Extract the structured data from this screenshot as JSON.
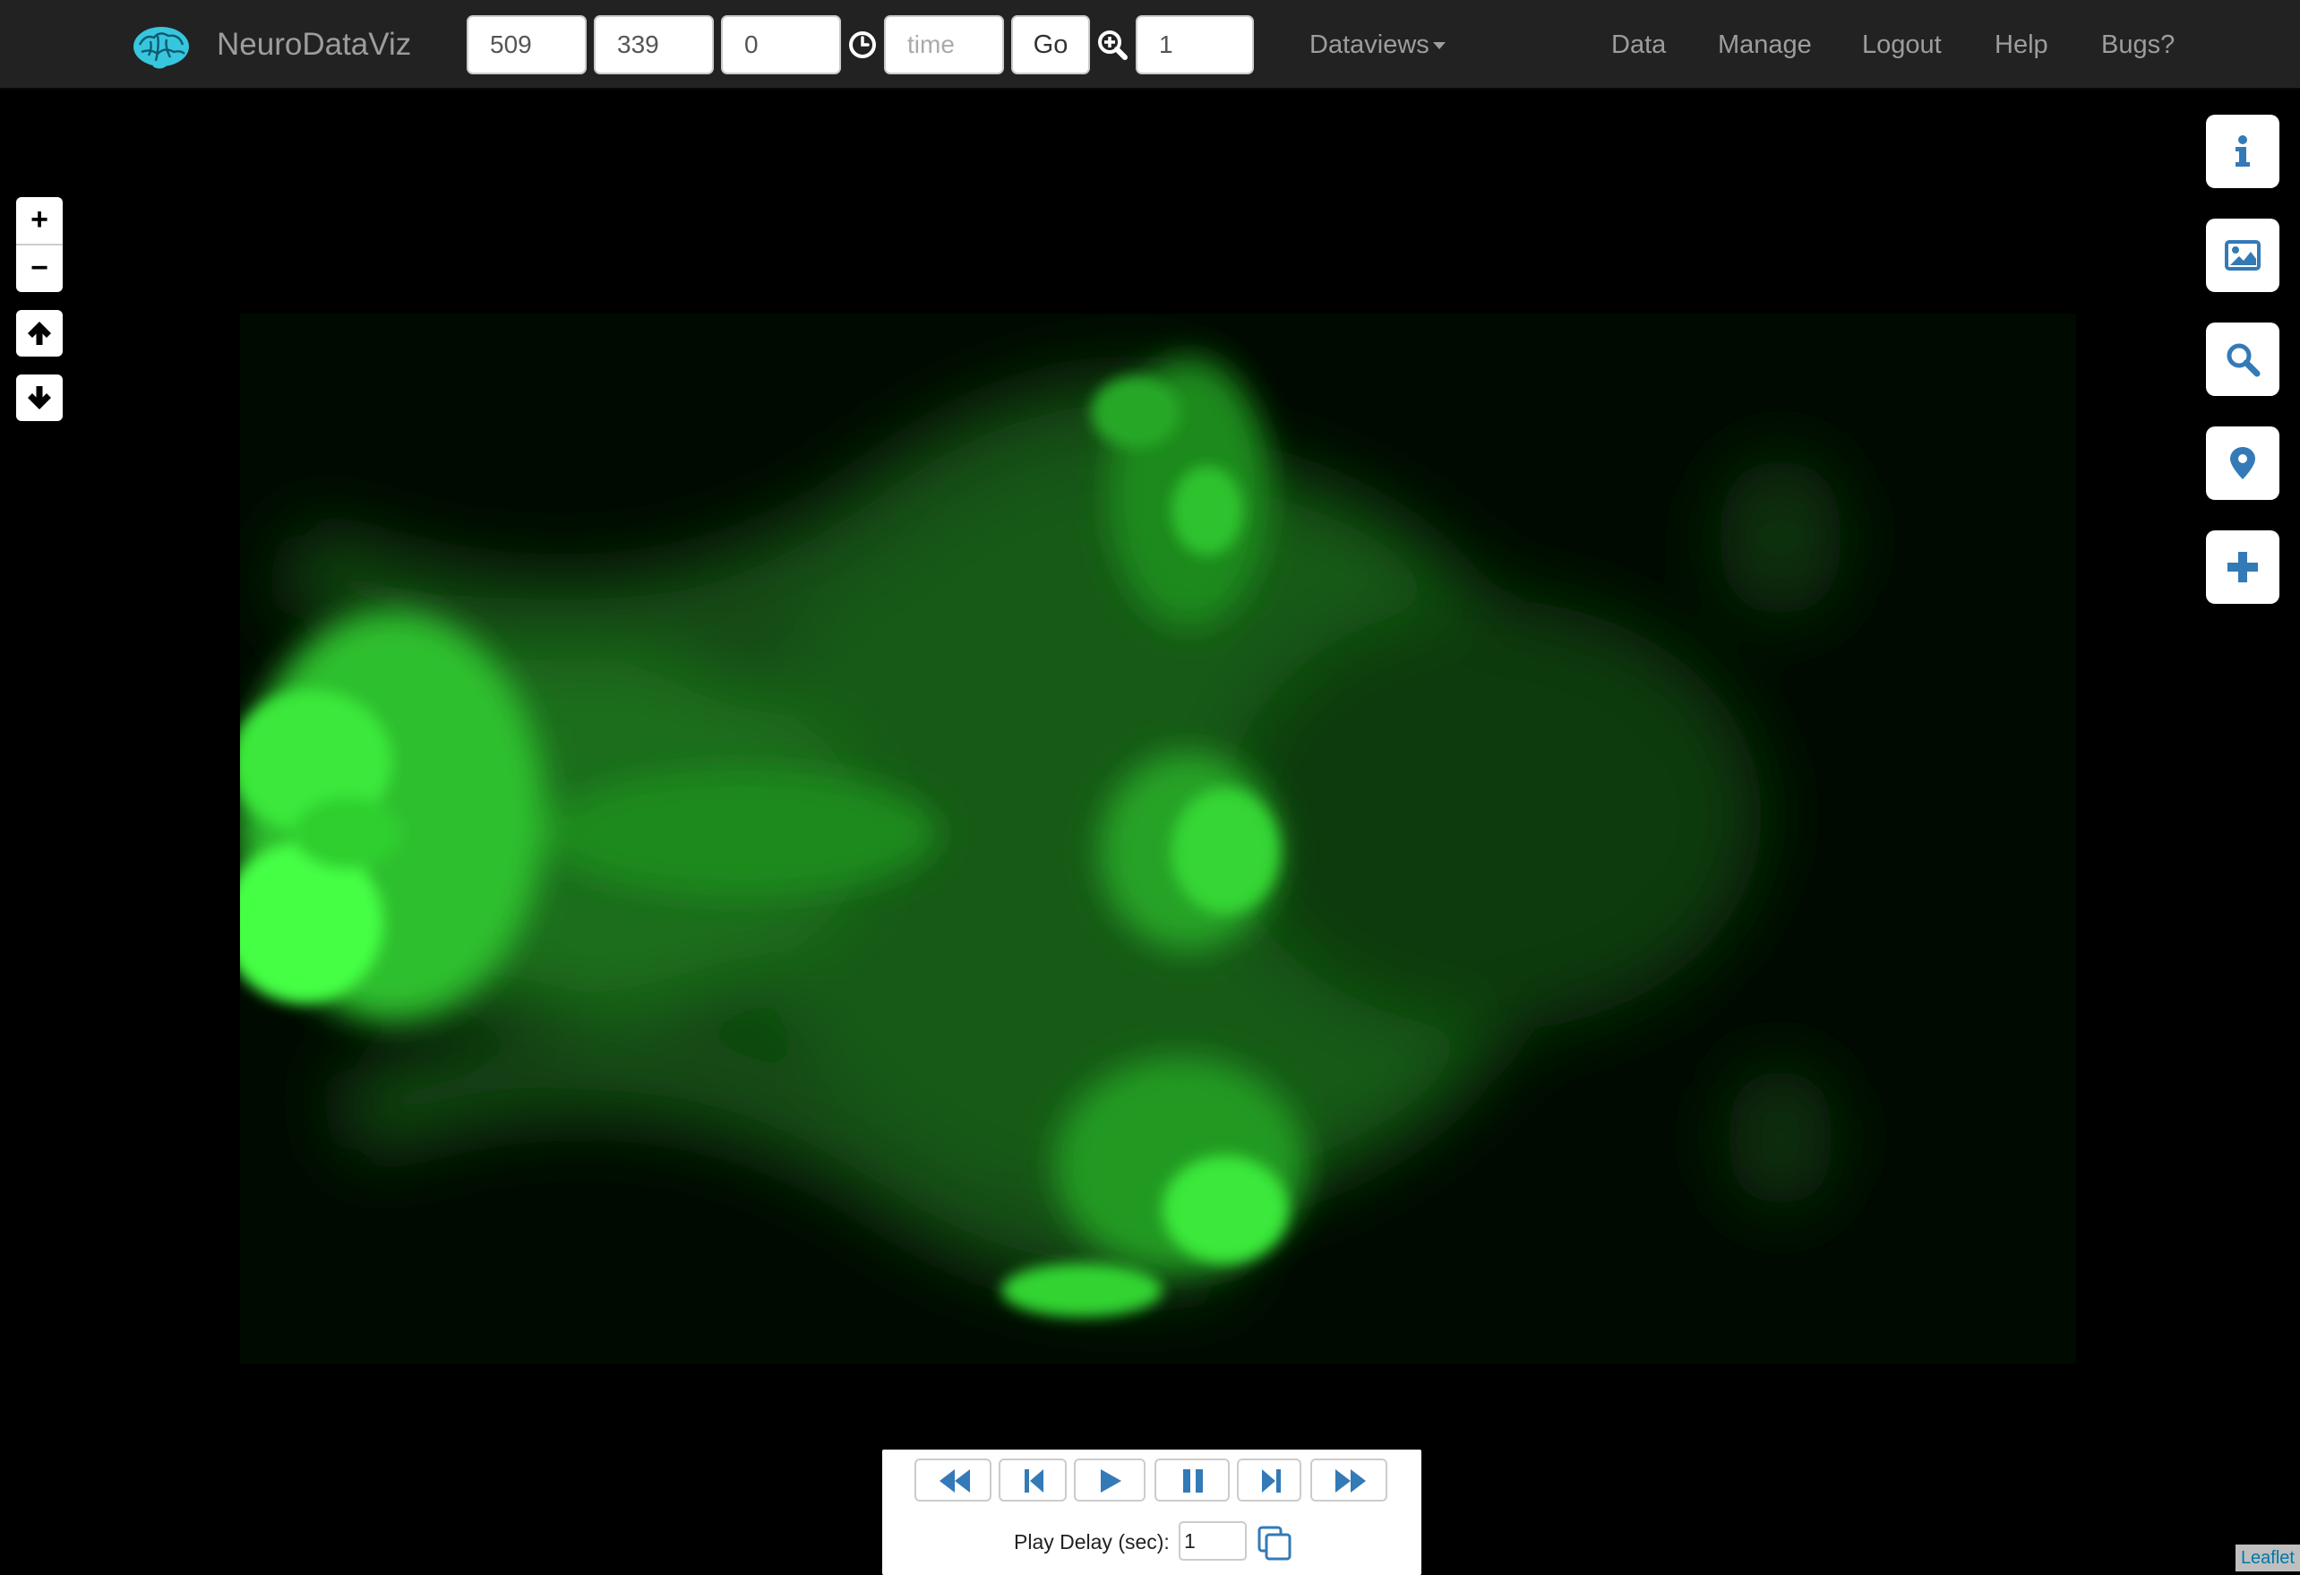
{
  "navbar": {
    "brand": "NeuroDataViz",
    "x_value": "509",
    "y_value": "339",
    "z_value": "0",
    "time_placeholder": "time",
    "go_label": "Go",
    "zoom_value": "1",
    "dataviews_label": "Dataviews",
    "links": {
      "data": "Data",
      "manage": "Manage",
      "logout": "Logout",
      "help": "Help",
      "bugs": "Bugs?"
    }
  },
  "map": {
    "zoom_in": "+",
    "zoom_out": "−",
    "side_buttons": [
      "info-icon",
      "image-icon",
      "search-icon",
      "map-marker-icon",
      "plus-icon"
    ],
    "nav_buttons": [
      "arrow-up-icon",
      "arrow-down-icon"
    ]
  },
  "playback": {
    "buttons": [
      "fast-backward-icon",
      "step-backward-icon",
      "play-icon",
      "pause-icon",
      "step-forward-icon",
      "fast-forward-icon"
    ],
    "delay_label": "Play Delay (sec):",
    "delay_value": "1"
  },
  "attribution": "Leaflet",
  "colors": {
    "navbar_bg": "#222222",
    "accent": "#337ab7",
    "fluorescence": "#22ff22"
  }
}
